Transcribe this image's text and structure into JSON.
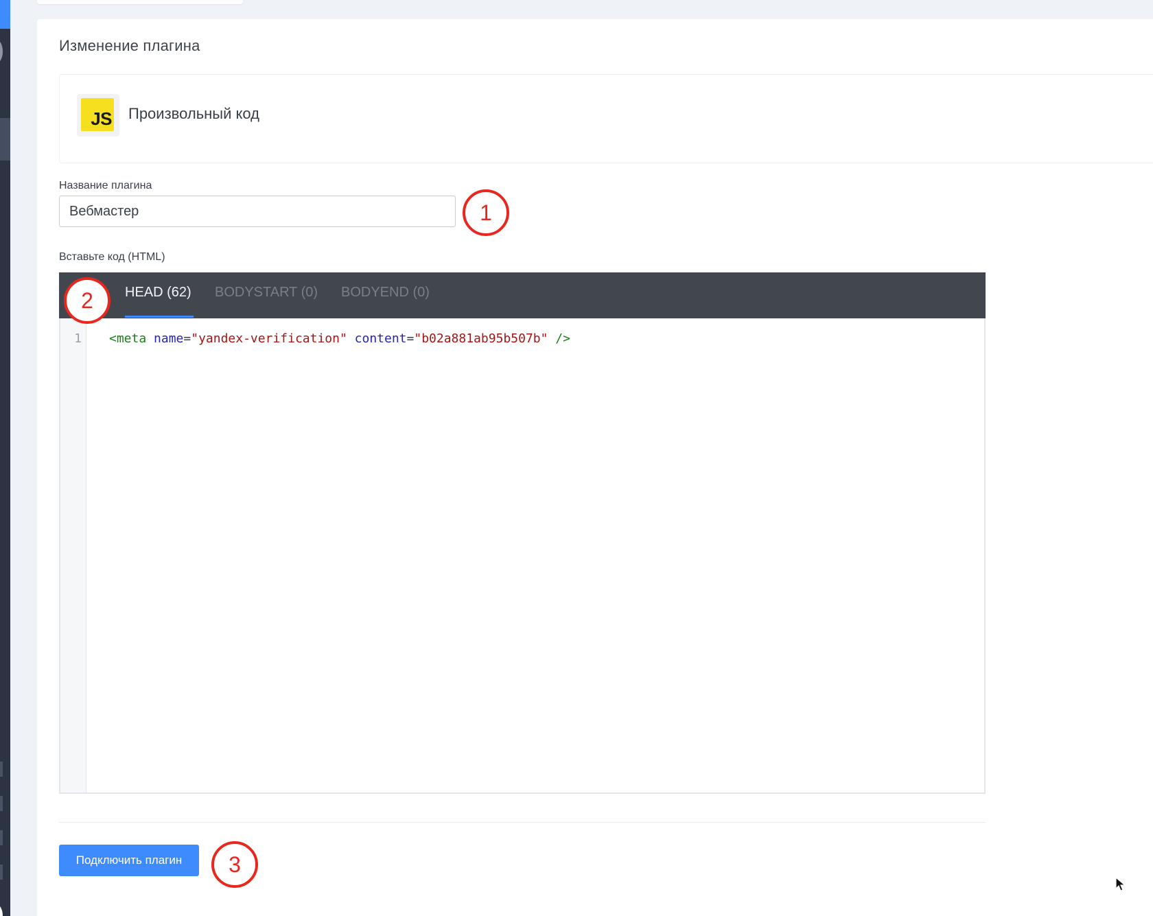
{
  "page": {
    "title": "Изменение плагина"
  },
  "plugin": {
    "logo_text": "JS",
    "name": "Произвольный код"
  },
  "form": {
    "name_label": "Название плагина",
    "name_value": "Вебмастер",
    "code_label": "Вставьте код (HTML)"
  },
  "editor": {
    "tabs": [
      {
        "label": "HEAD (62)",
        "active": true
      },
      {
        "label": "BODYSTART (0)",
        "active": false
      },
      {
        "label": "BODYEND (0)",
        "active": false
      }
    ],
    "lines": [
      {
        "number": "1",
        "tokens": {
          "open": "<meta ",
          "attr1": "name",
          "eq1": "=",
          "val1": "\"yandex-verification\"",
          "sp": " ",
          "attr2": "content",
          "eq2": "=",
          "val2": "\"b02a881ab95b507b\"",
          "close": " />"
        }
      }
    ]
  },
  "actions": {
    "submit_label": "Подключить плагин"
  },
  "annotations": [
    "1",
    "2",
    "3"
  ],
  "colors": {
    "accent": "#3d8bfd",
    "sidebar": "#2c3444",
    "tabbar": "#42464e",
    "annotation": "#e8281f",
    "js_yellow": "#f6df1f"
  }
}
